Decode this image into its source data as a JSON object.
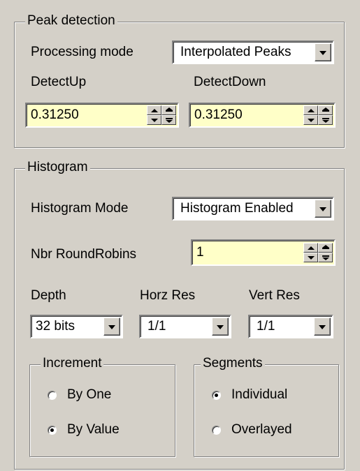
{
  "peak": {
    "title": "Peak detection",
    "processing_label": "Processing mode",
    "processing_value": "Interpolated Peaks",
    "detect_up_label": "DetectUp",
    "detect_down_label": "DetectDown",
    "detect_up_value": "0.31250",
    "detect_down_value": "0.31250"
  },
  "histogram": {
    "title": "Histogram",
    "mode_label": "Histogram Mode",
    "mode_value": "Histogram Enabled",
    "roundrobins_label": "Nbr RoundRobins",
    "roundrobins_value": "1",
    "depth_label": "Depth",
    "horz_label": "Horz Res",
    "vert_label": "Vert Res",
    "depth_value": "32 bits",
    "horz_value": "1/1",
    "vert_value": "1/1",
    "increment": {
      "title": "Increment",
      "options": [
        {
          "label": "By One",
          "checked": false
        },
        {
          "label": "By Value",
          "checked": true
        }
      ]
    },
    "segments": {
      "title": "Segments",
      "options": [
        {
          "label": "Individual",
          "checked": true
        },
        {
          "label": "Overlayed",
          "checked": false
        }
      ]
    }
  },
  "colors": {
    "background": "#d4d0c8",
    "edit_background": "#ffffc8"
  }
}
